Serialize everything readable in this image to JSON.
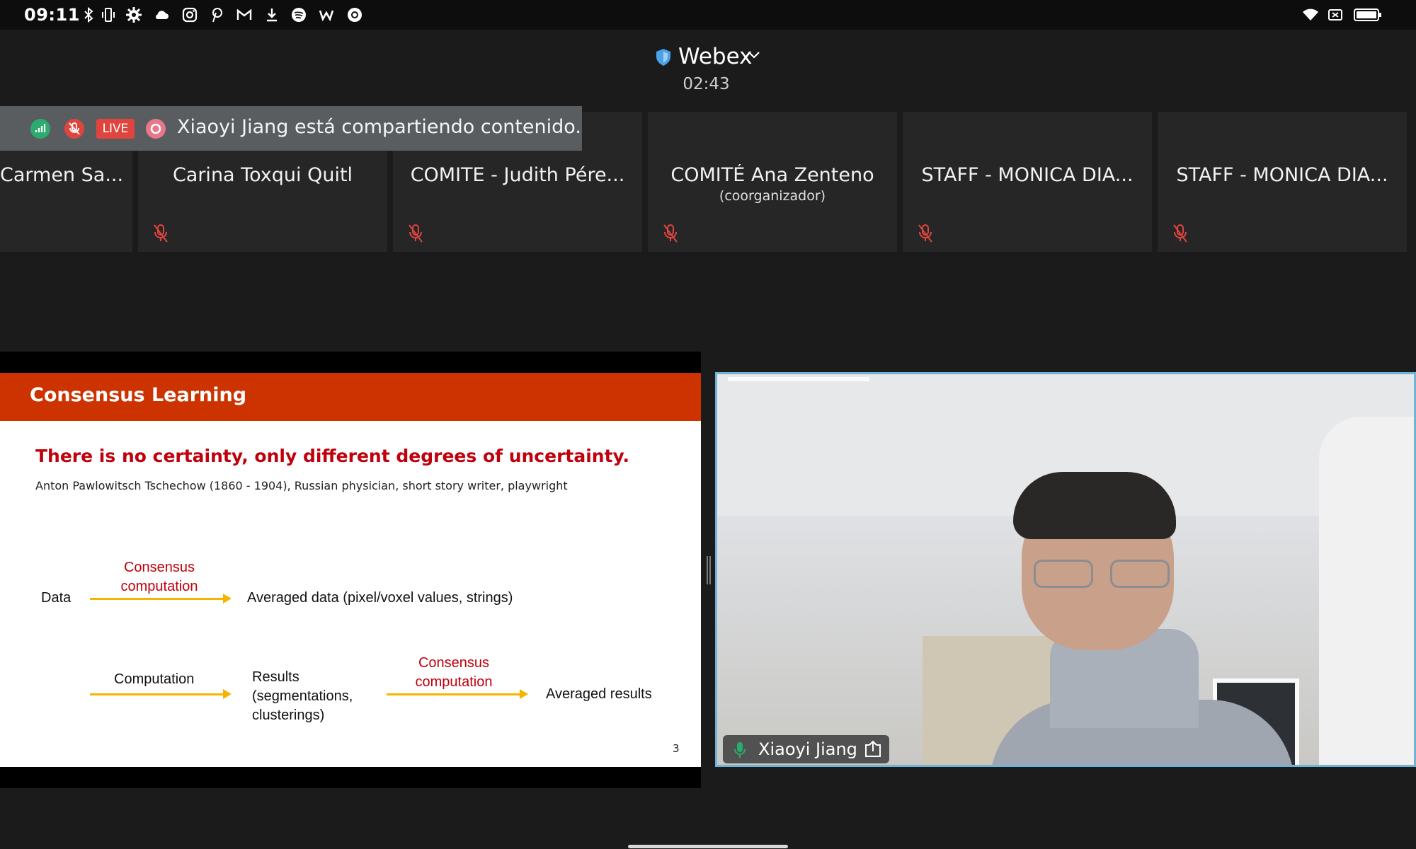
{
  "status_bar": {
    "time": "09:11",
    "left_icons": [
      "bluetooth-icon",
      "vibrate-icon",
      "settings-icon",
      "cloud-icon",
      "instagram-icon",
      "pinterest-icon",
      "gmail-icon",
      "download-icon",
      "spotify-icon",
      "app-icon",
      "circle-app-icon"
    ],
    "right_icons": [
      "wifi-icon",
      "no-sim-icon",
      "battery-icon"
    ]
  },
  "header": {
    "app_name": "Webex",
    "elapsed": "02:43"
  },
  "banner": {
    "live_label": "LIVE",
    "text": "Xiaoyi Jiang está compartiendo contenido."
  },
  "participants": [
    {
      "name": "Carmen Sa...",
      "role": "",
      "muted": false
    },
    {
      "name": "Carina Toxqui Quitl",
      "role": "",
      "muted": true
    },
    {
      "name": "COMITE - Judith Pére...",
      "role": "",
      "muted": true
    },
    {
      "name": "COMITÉ Ana Zenteno",
      "role": "(coorganizador)",
      "muted": true
    },
    {
      "name": "STAFF - MONICA DIA...",
      "role": "",
      "muted": true
    },
    {
      "name": "STAFF - MONICA DIA...",
      "role": "",
      "muted": true
    }
  ],
  "slide": {
    "title": "Consensus Learning",
    "quote": "There is no certainty, only different degrees of uncertainty.",
    "attribution": "Anton Pawlowitsch Tschechow (1860 - 1904), Russian physician, short story writer, playwright",
    "row1": {
      "input": "Data",
      "arrow_label_1": "Consensus",
      "arrow_label_2": "computation",
      "output": "Averaged data (pixel/voxel values, strings)"
    },
    "row2": {
      "arrow_label": "Computation",
      "results_1": "Results",
      "results_2": "(segmentations,",
      "results_3": "clusterings)",
      "arrow2_label_1": "Consensus",
      "arrow2_label_2": "computation",
      "output": "Averaged results"
    },
    "page_number": "3"
  },
  "video": {
    "speaker_name": "Xiaoyi Jiang"
  },
  "colors": {
    "accent_orange": "#cc3300",
    "quote_red": "#c0000b",
    "arrow_yellow": "#f5b400",
    "video_border": "#6fb4d6",
    "mute_red": "#e0443e",
    "live_red": "#e0443e"
  }
}
